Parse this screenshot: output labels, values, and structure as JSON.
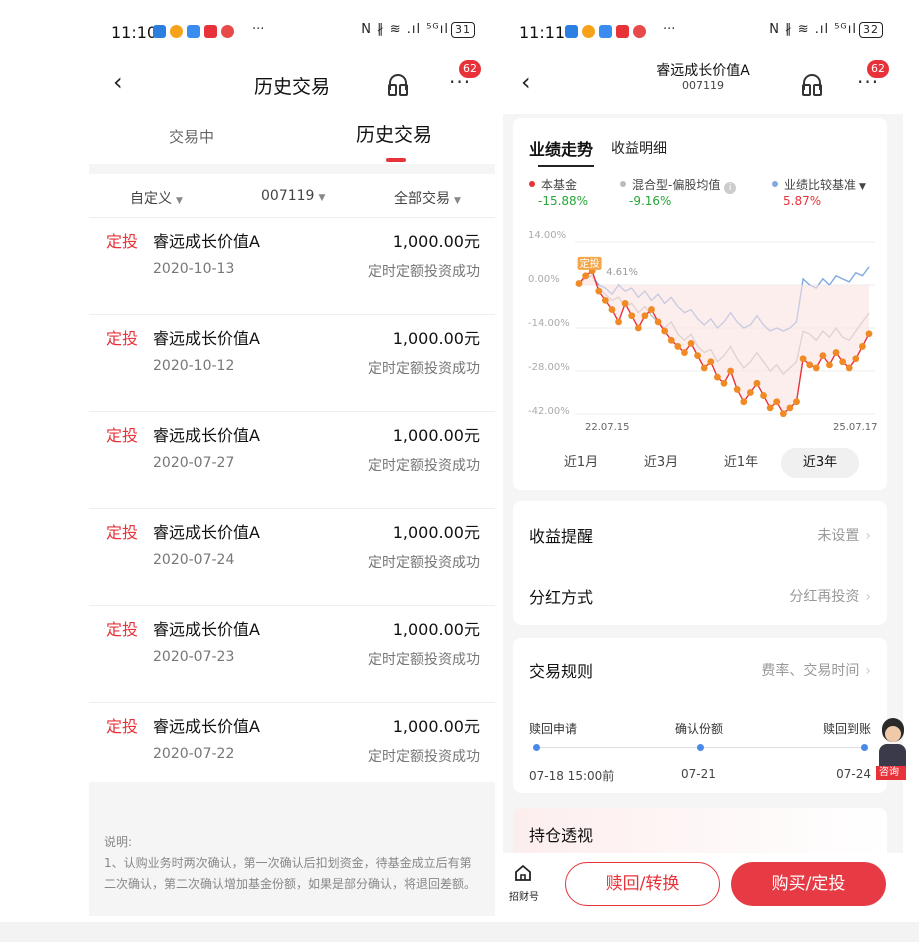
{
  "left": {
    "status": {
      "time": "11:10",
      "dots": "···",
      "right_icons": "N ∦ ≋ .ıl ⁵ᴳıl",
      "battery": "31"
    },
    "title": "历史交易",
    "badge": "62",
    "tabs": [
      "交易中",
      "历史交易"
    ],
    "filters": [
      "自定义",
      "007119",
      "全部交易"
    ],
    "rows": [
      {
        "tag": "定投",
        "name": "睿远成长价值A",
        "amount": "1,000.00元",
        "date": "2020-10-13",
        "status": "定时定额投资成功"
      },
      {
        "tag": "定投",
        "name": "睿远成长价值A",
        "amount": "1,000.00元",
        "date": "2020-10-12",
        "status": "定时定额投资成功"
      },
      {
        "tag": "定投",
        "name": "睿远成长价值A",
        "amount": "1,000.00元",
        "date": "2020-07-27",
        "status": "定时定额投资成功"
      },
      {
        "tag": "定投",
        "name": "睿远成长价值A",
        "amount": "1,000.00元",
        "date": "2020-07-24",
        "status": "定时定额投资成功"
      },
      {
        "tag": "定投",
        "name": "睿远成长价值A",
        "amount": "1,000.00元",
        "date": "2020-07-23",
        "status": "定时定额投资成功"
      },
      {
        "tag": "定投",
        "name": "睿远成长价值A",
        "amount": "1,000.00元",
        "date": "2020-07-22",
        "status": "定时定额投资成功"
      }
    ],
    "note_title": "说明:",
    "note_text": "1、认购业务时两次确认，第一次确认后扣划资金，待基金成立后有第二次确认，第二次确认增加基金份额，如果是部分确认，将退回差额。"
  },
  "right": {
    "status": {
      "time": "11:11",
      "dots": "···",
      "right_icons": "N ∦ ≋ .ıl ⁵ᴳıl",
      "battery": "32"
    },
    "title": "睿远成长价值A",
    "code": "007119",
    "badge": "62",
    "chart_tabs": [
      "业绩走势",
      "收益明细"
    ],
    "legend": [
      {
        "name": "本基金",
        "value": "-15.88%",
        "color": "#e8323a"
      },
      {
        "name": "混合型-偏股均值",
        "value": "-9.16%",
        "color": "#bbbbbb"
      },
      {
        "name": "业绩比较基准",
        "value": "5.87%",
        "color": "#7fa9e0"
      }
    ],
    "ranges": [
      "近1月",
      "近3月",
      "近1年",
      "近3年"
    ],
    "active_range": "近3年",
    "income_alert": {
      "label": "收益提醒",
      "value": "未设置"
    },
    "dividend": {
      "label": "分红方式",
      "value": "分红再投资"
    },
    "rules": {
      "label": "交易规则",
      "value": "费率、交易时间"
    },
    "steps": [
      {
        "label": "赎回申请",
        "date": "07-18 15:00前"
      },
      {
        "label": "确认份额",
        "date": "07-21"
      },
      {
        "label": "赎回到账",
        "date": "07-24"
      }
    ],
    "holding": "持仓透视",
    "bottom": {
      "home": "招财号",
      "redeem": "赎回/转换",
      "buy": "购买/定投"
    },
    "consult": "咨询"
  },
  "chart_data": {
    "type": "line",
    "yticks": [
      "14.00%",
      "0.00%",
      "-14.00%",
      "-28.00%",
      "-42.00%"
    ],
    "ylim": [
      -42,
      14
    ],
    "x_start_label": "22.07.15",
    "x_end_label": "25.07.17",
    "annotations": {
      "tag": "定投",
      "max": "4.61%",
      "min": "-41.89%"
    },
    "series": [
      {
        "name": "本基金",
        "color": "#e8323a",
        "final": -15.88,
        "values": [
          0.5,
          3,
          4.61,
          -2,
          -5,
          -8,
          -12,
          -6,
          -10,
          -14,
          -10,
          -8,
          -12,
          -15,
          -18,
          -20,
          -22,
          -19,
          -23,
          -27,
          -25,
          -30,
          -32,
          -28,
          -34,
          -38,
          -35,
          -32,
          -36,
          -40,
          -38,
          -41.89,
          -40,
          -38,
          -24,
          -26,
          -27,
          -23,
          -26,
          -22,
          -25,
          -27,
          -24,
          -20,
          -15.88
        ]
      },
      {
        "name": "混合型-偏股均值",
        "color": "#bbbbbb",
        "final": -9.16,
        "values": [
          0.5,
          2,
          3,
          -1,
          -3,
          -5,
          -4,
          -7,
          -6,
          -9,
          -7,
          -10,
          -12,
          -14,
          -12,
          -16,
          -18,
          -16,
          -20,
          -22,
          -21,
          -25,
          -23,
          -20,
          -24,
          -27,
          -25,
          -22,
          -25,
          -28,
          -26,
          -29,
          -27,
          -25,
          -15,
          -16,
          -18,
          -15,
          -17,
          -14,
          -17,
          -18,
          -15,
          -12,
          -9.16
        ]
      },
      {
        "name": "业绩比较基准",
        "color": "#7fa9e0",
        "final": 5.87,
        "values": [
          0.5,
          2.5,
          3,
          0,
          -1,
          -3,
          0,
          -2,
          -1,
          -4,
          -2,
          -5,
          -3,
          -6,
          -4,
          -7,
          -9,
          -8,
          -11,
          -13,
          -11,
          -14,
          -12,
          -9,
          -12,
          -14,
          -13,
          -10,
          -13,
          -15,
          -14,
          -15,
          -14,
          -12,
          2,
          0,
          -1,
          2,
          0,
          3,
          2,
          1,
          4,
          3,
          5.87
        ]
      }
    ],
    "range_buttons": [
      "近1月",
      "近3月",
      "近1年",
      "近3年"
    ]
  }
}
